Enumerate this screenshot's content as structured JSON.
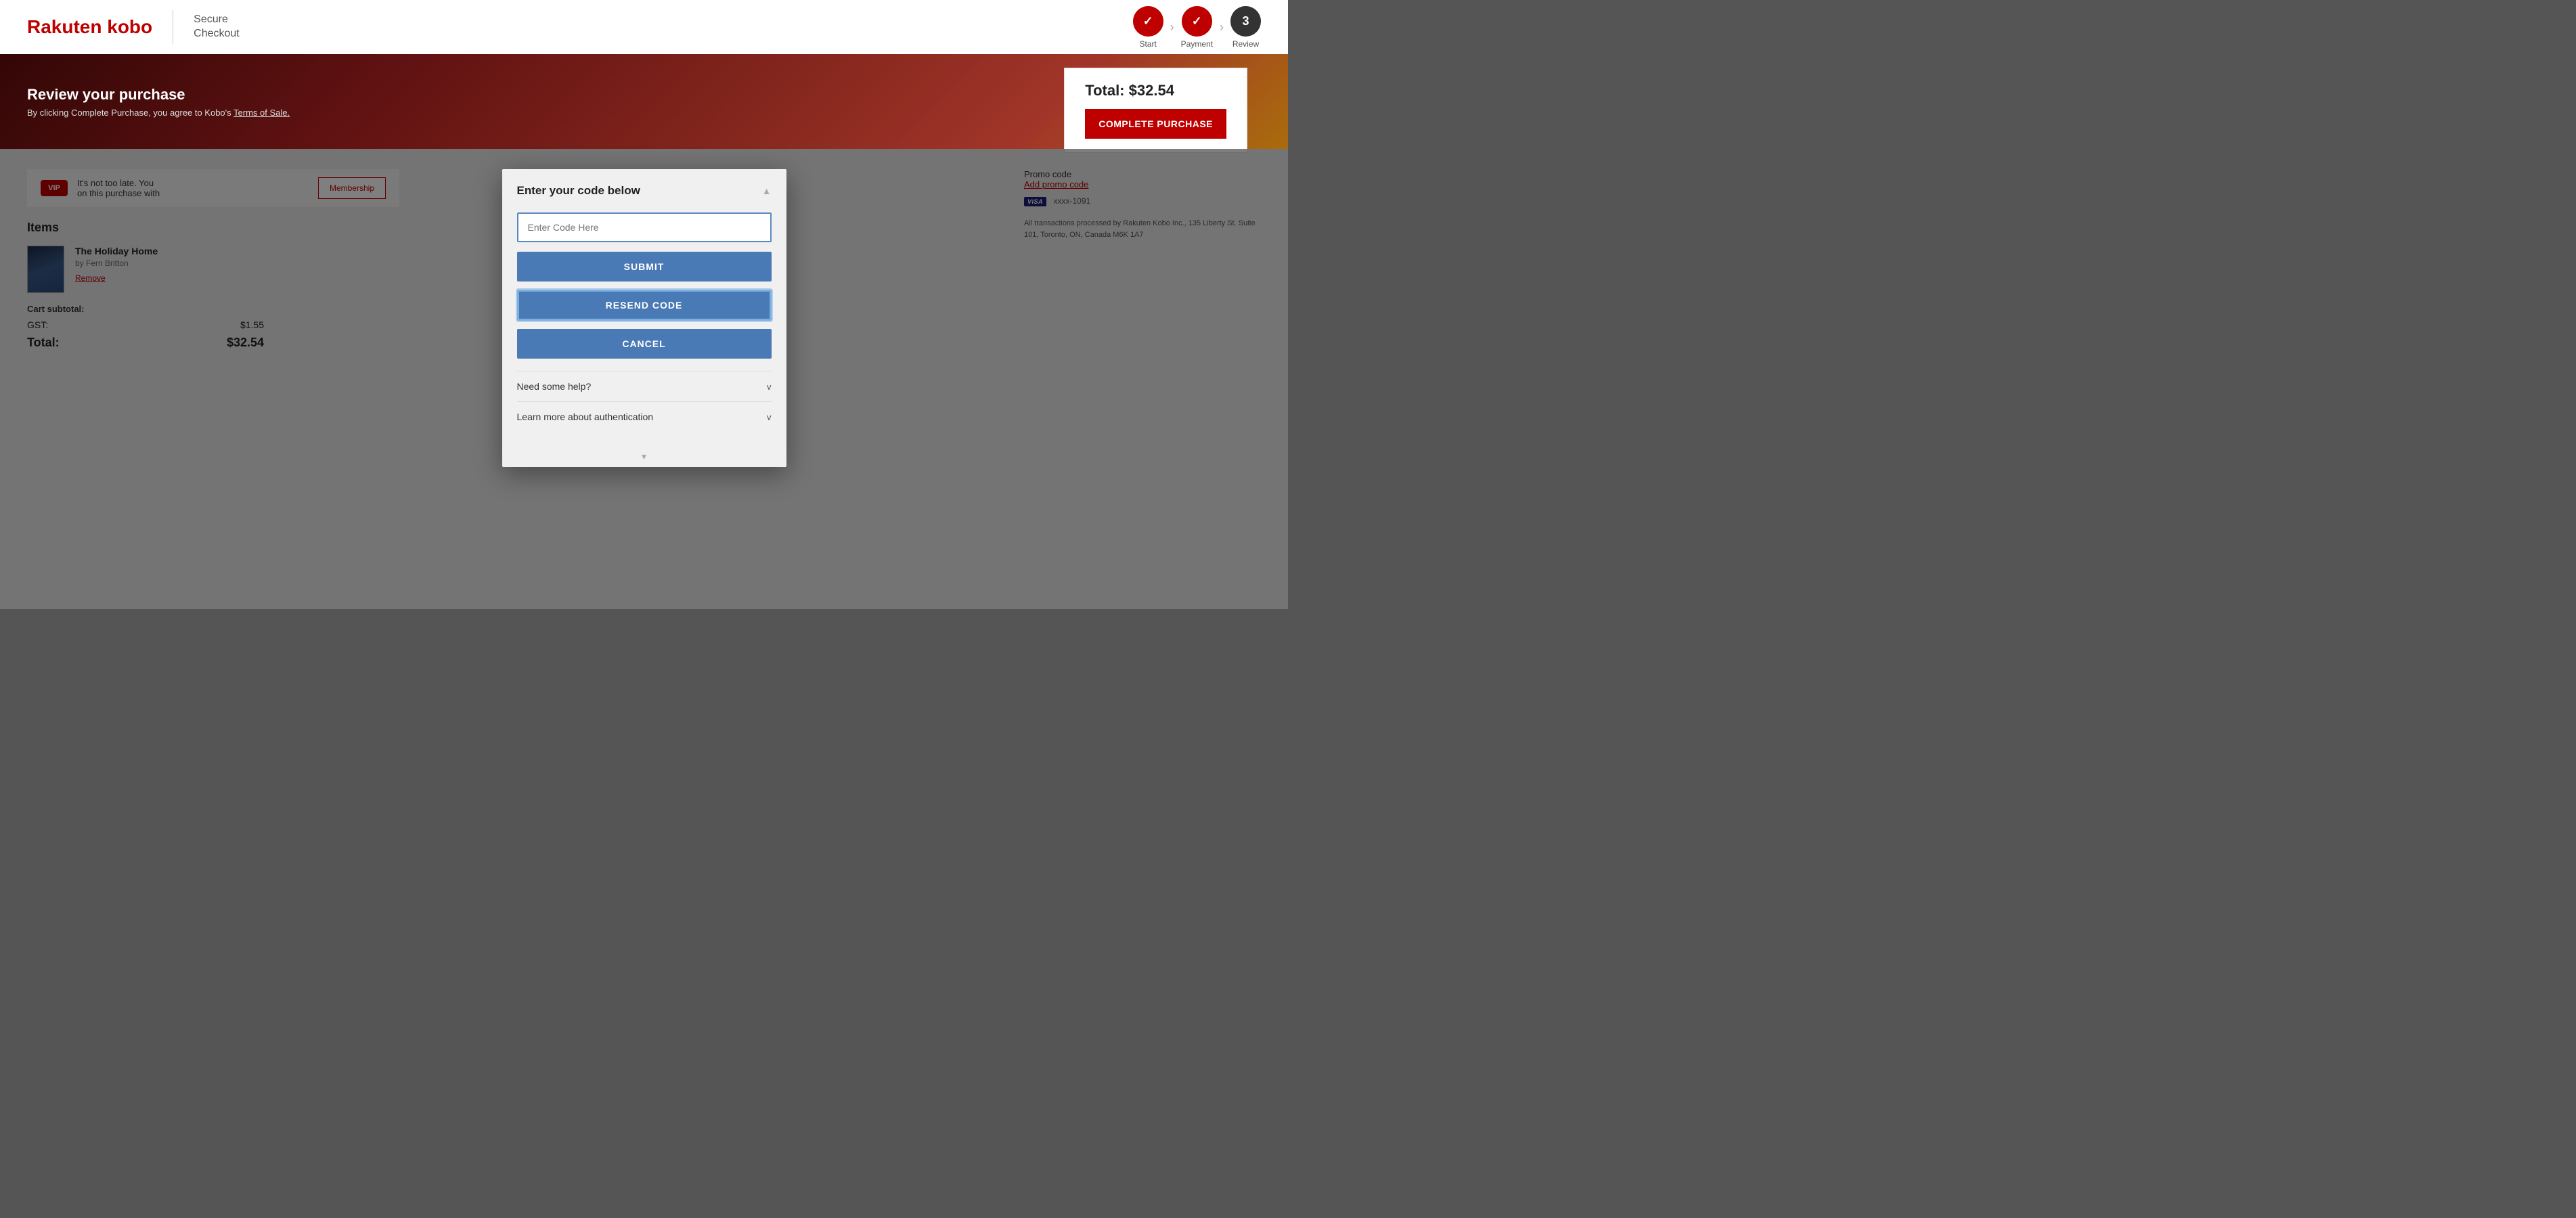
{
  "header": {
    "logo": {
      "rakuten": "Rakuten",
      "kobo": " kobo"
    },
    "secure_checkout_line1": "Secure",
    "secure_checkout_line2": "Checkout",
    "steps": [
      {
        "id": "start",
        "label": "Start",
        "state": "done",
        "display": "✓"
      },
      {
        "id": "payment",
        "label": "Payment",
        "state": "done",
        "display": "✓"
      },
      {
        "id": "review",
        "label": "Review",
        "state": "active",
        "display": "3"
      }
    ]
  },
  "hero": {
    "title": "Review your purchase",
    "subtitle": "By clicking Complete Purchase, you agree to Kobo's Terms of Sale."
  },
  "total_card": {
    "label": "Total:",
    "amount": "$32.54",
    "cta_button": "Complete Purchase"
  },
  "vip": {
    "badge": "VIP",
    "text": "It's not too late. You",
    "text2": "on this purchase with",
    "membership_btn": "Membership"
  },
  "items_section": {
    "title": "Items",
    "items": [
      {
        "title": "The Holiday Home",
        "author": "by Fern Britton",
        "remove_label": "Remove"
      }
    ]
  },
  "cart": {
    "subtotal_label": "Cart subtotal:",
    "gst_label": "GST:",
    "gst_value": "$1.55",
    "total_label": "Total:",
    "total_value": "$32.54"
  },
  "right_sidebar": {
    "promo_label": "Promo code",
    "add_promo": "Add promo code",
    "card_prefix": "xxxx-1091",
    "transactions_text": "All transactions processed by Rakuten Kobo Inc., 135 Liberty St. Suite 101, Toronto, ON, Canada M6K 1A7"
  },
  "modal": {
    "title": "Enter your code below",
    "code_input_placeholder": "Enter Code Here",
    "submit_label": "SUBMIT",
    "resend_label": "RESEND CODE",
    "cancel_label": "CANCEL",
    "accordion_items": [
      {
        "title": "Need some help?",
        "arrow": "v"
      },
      {
        "title": "Learn more about authentication",
        "arrow": "v"
      }
    ]
  }
}
